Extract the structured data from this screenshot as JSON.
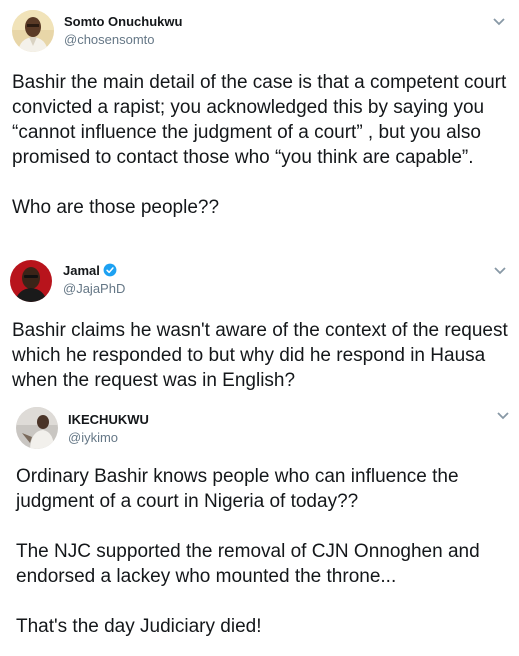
{
  "tweets": [
    {
      "name": "Somto Onuchukwu",
      "handle": "@chosensomto",
      "verified": false,
      "paragraphs": [
        "Bashir the main detail of the case is that a competent court convicted a rapist; you acknowledged this by saying you “cannot influence the judgment of a court” , but you also promised to contact those who “you think are capable”.",
        "Who are those people??"
      ]
    },
    {
      "name": "Jamal",
      "handle": "@JajaPhD",
      "verified": true,
      "paragraphs": [
        "Bashir claims he wasn't aware of the context of the request which he responded to but why did he respond in Hausa when the request was in English?"
      ]
    },
    {
      "name": "IKECHUKWU",
      "handle": "@iykimo",
      "verified": false,
      "paragraphs": [
        "Ordinary Bashir knows people who can influence the judgment of a court in Nigeria of today??",
        "The NJC supported the removal of CJN Onnoghen and endorsed a lackey who mounted the throne...",
        "That's the day Judiciary died!"
      ]
    }
  ],
  "icons": {
    "menu": "chevron-down-icon",
    "verified": "verified-badge-icon"
  },
  "colors": {
    "text": "#14171a",
    "secondary": "#657786",
    "verified": "#1da1f2",
    "divider": "#e6ecf0"
  }
}
